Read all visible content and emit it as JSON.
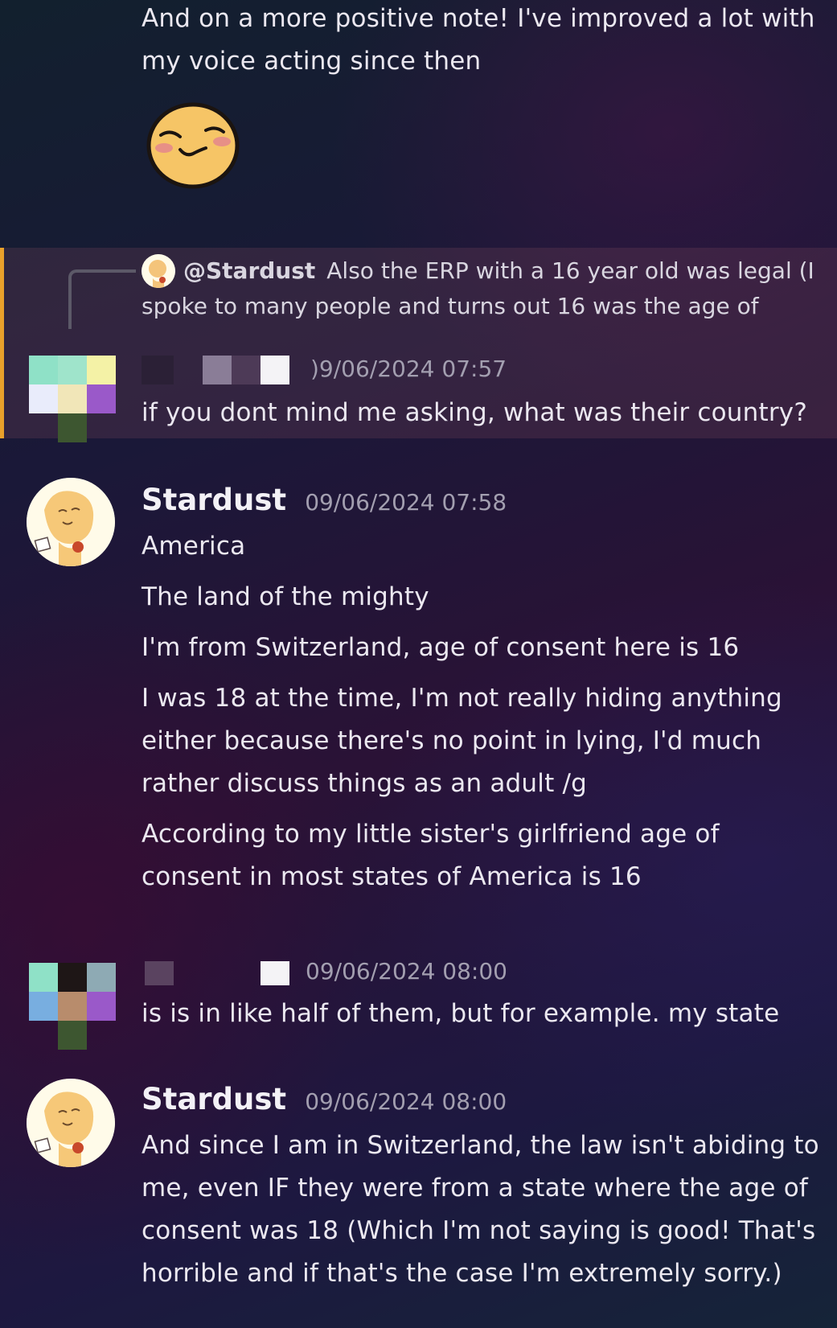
{
  "top_message": {
    "lines": [
      "And on a more positive note! I've improved a lot with",
      "my voice acting since then"
    ],
    "emoji": "blushing-smile-emoji"
  },
  "reply_preview": {
    "mention": "@Stardust",
    "text_line1": "Also the ERP with a 16 year old was legal (I",
    "text_line2": "spoke to many people and turns out 16 was the age of"
  },
  "messages": [
    {
      "author": "",
      "timestamp": ")9/06/2024 07:57",
      "lines": [
        "if you dont mind me asking, what was their country?"
      ]
    },
    {
      "author": "Stardust",
      "timestamp": "09/06/2024 07:58",
      "lines": [
        "America",
        "The land of the mighty",
        "I'm from Switzerland, age of consent here is 16",
        "I was 18 at the time, I'm not really hiding anything",
        "either because there's no point in lying, I'd much",
        "rather discuss things as an adult /g",
        "According to my little sister's girlfriend age of",
        "consent in most states of America is 16"
      ]
    },
    {
      "author": "",
      "timestamp": "09/06/2024 08:00",
      "lines": [
        "is is in like half of them, but for example. my state"
      ]
    },
    {
      "author": "Stardust",
      "timestamp": "09/06/2024 08:00",
      "lines": [
        "And since I am in Switzerland, the law isn't abiding to",
        "me, even IF they were from a state where the age of",
        "consent was 18 (Which I'm not saying is good! That's",
        "horrible and if that's the case I'm extremely sorry.)"
      ]
    }
  ],
  "colors": {
    "highlight_bar": "#e9a12b",
    "timestamp": "#a39fb0",
    "text": "#ebe8f0"
  }
}
